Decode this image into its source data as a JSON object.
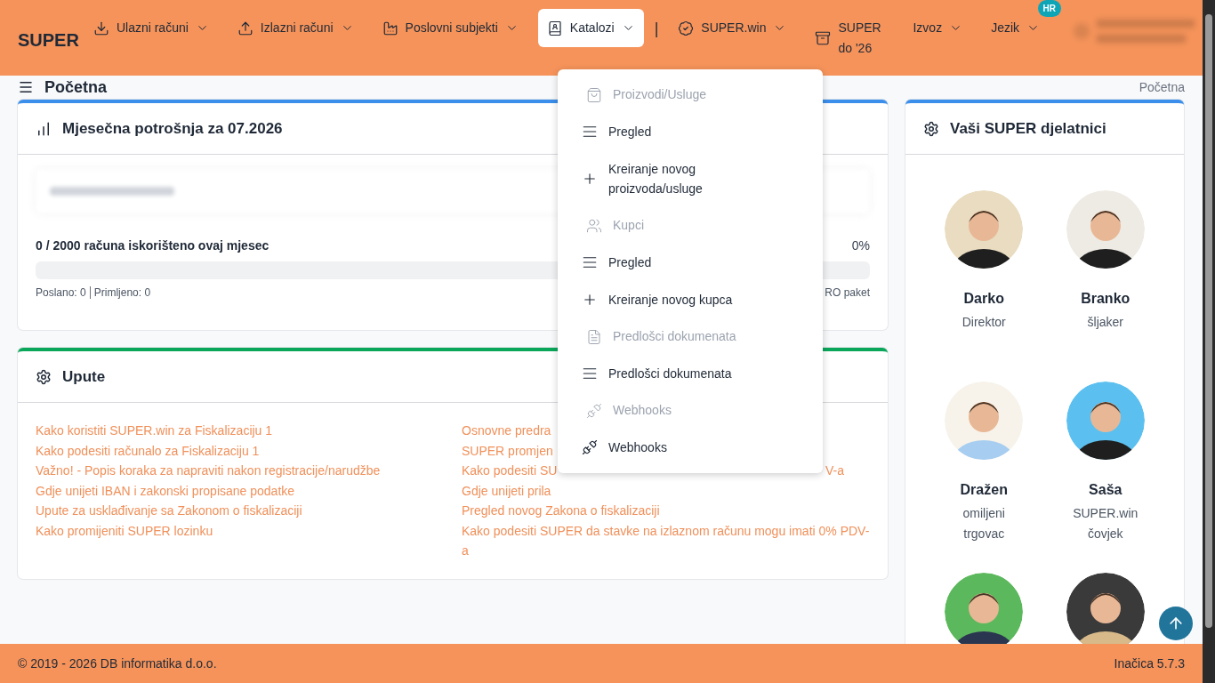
{
  "header": {
    "brand": "SUPER",
    "nav": [
      {
        "label": "Ulazni računi",
        "has_menu": true,
        "selected": false
      },
      {
        "label": "Izlazni računi",
        "has_menu": true,
        "selected": false
      },
      {
        "label": "Poslovni subjekti",
        "has_menu": true,
        "selected": false
      },
      {
        "label": "Katalozi",
        "has_menu": true,
        "selected": true
      },
      {
        "label": "SUPER.win",
        "has_menu": true,
        "selected": false
      },
      {
        "label": "SUPER do '26",
        "has_menu": false,
        "selected": false
      },
      {
        "label": "Izvoz",
        "has_menu": true,
        "selected": false
      },
      {
        "label": "Jezik",
        "has_menu": true,
        "selected": false,
        "badge": "HR"
      }
    ],
    "separator": "|"
  },
  "page": {
    "title": "Početna",
    "breadcrumb": "Početna"
  },
  "usage_card": {
    "title": "Mjesečna potrošnja za 07.2026",
    "usage_text": "0 / 2000 računa iskorišteno ovaj mjesec",
    "percent": "0%",
    "level": 0,
    "sent": "Poslano: 0",
    "received": "Primljeno: 0",
    "package": "RO paket"
  },
  "guides_card": {
    "title": "Upute",
    "links_left": [
      "Kako koristiti SUPER.win za Fiskalizaciju 1",
      "Kako podesiti računalo za Fiskalizaciju 1",
      "Važno! - Popis koraka za napraviti nakon registracije/narudžbe",
      "Gdje unijeti IBAN i zakonski propisane podatke",
      "Upute za usklađivanje sa Zakonom o fiskalizaciji",
      "Kako promijeniti SUPER lozinku"
    ],
    "links_right": [
      {
        "text": "Osnovne predra"
      },
      {
        "text": "SUPER promjen"
      },
      {
        "text": "Kako podesiti SU",
        "tail": "V-a"
      },
      {
        "text": "Gdje unijeti prila"
      },
      {
        "text": "Pregled novog Zakona o fiskalizaciji"
      },
      {
        "text": "Kako podesiti SUPER da stavke na izlaznom računu mogu imati 0% PDV-a"
      }
    ]
  },
  "staff_card": {
    "title": "Vaši SUPER djelatnici",
    "people": [
      {
        "kind": "person",
        "name": "Darko",
        "role": "Direktor"
      },
      {
        "kind": "person",
        "name": "Branko",
        "role": "šljaker"
      },
      {
        "kind": "person",
        "name": "Dražen",
        "role": "omiljeni trgovac"
      },
      {
        "kind": "person",
        "name": "Saša",
        "role": "SUPER.win čovjek"
      },
      {
        "kind": "picture"
      },
      {
        "kind": "picture"
      }
    ]
  },
  "catalog_menu": [
    {
      "kind": "section",
      "label": "Proizvodi/Usluge"
    },
    {
      "kind": "link",
      "label": "Pregled"
    },
    {
      "kind": "link",
      "label": "Kreiranje novog proizvoda/usluge"
    },
    {
      "kind": "section",
      "label": "Kupci"
    },
    {
      "kind": "link",
      "label": "Pregled"
    },
    {
      "kind": "link",
      "label": "Kreiranje novog kupca"
    },
    {
      "kind": "section",
      "label": "Predlošci dokumenata"
    },
    {
      "kind": "link",
      "label": "Predlošci dokumenata"
    },
    {
      "kind": "section",
      "label": "Webhooks"
    },
    {
      "kind": "link",
      "label": "Webhooks"
    }
  ],
  "footer": {
    "copyright": "© 2019 - 2026 DB informatika d.o.o.",
    "version": "Inačica 5.7.3"
  }
}
